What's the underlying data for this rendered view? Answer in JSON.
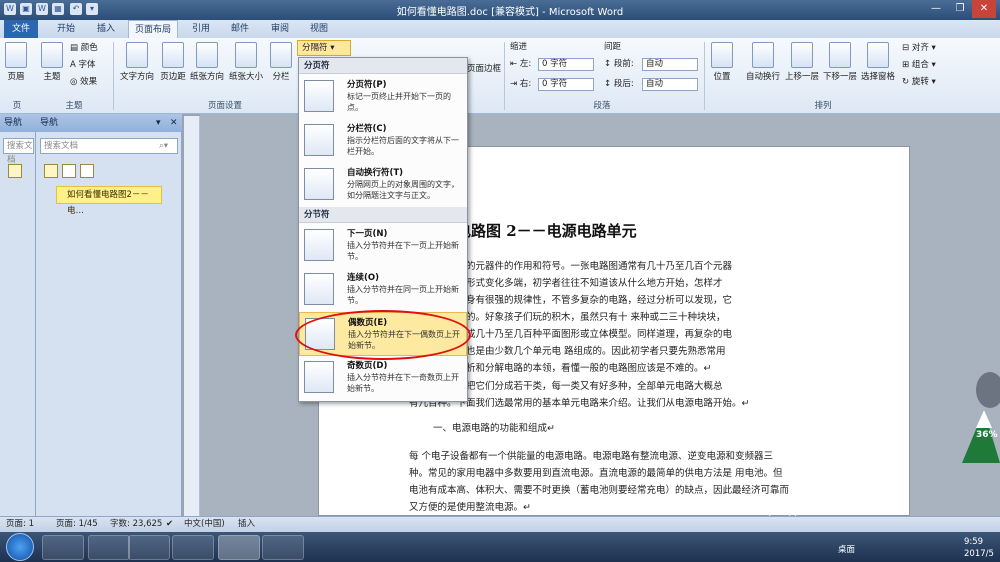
{
  "window": {
    "title": "如何看懂电路图.doc [兼容模式] - Microsoft Word",
    "minimize": "—",
    "maximize": "❐",
    "close": "✕"
  },
  "tabs": [
    "文件",
    "开始",
    "插入",
    "页面布局",
    "引用",
    "邮件",
    "审阅",
    "视图"
  ],
  "ribbon": {
    "theme_buttons": {
      "page": "页眉",
      "theme": "主题",
      "colors": "颜色",
      "fonts": "字体",
      "effects": "效果"
    },
    "page_setup_buttons": [
      "文字方向",
      "页边距",
      "纸张方向",
      "纸张大小",
      "分栏"
    ],
    "breaks_button": "分隔符",
    "page_border": "页面边框",
    "indent": {
      "label": "缩进",
      "left_label": "左",
      "left_value": "0 字符",
      "right_label": "右",
      "right_value": "0 字符"
    },
    "spacing": {
      "label": "间距",
      "before_label": "段前",
      "before_value": "自动",
      "after_label": "段后",
      "after_value": "自动"
    },
    "arrange_buttons": [
      "位置",
      "自动换行",
      "上移一层",
      "下移一层",
      "选择窗格"
    ],
    "arrange_small": [
      "对齐",
      "组合",
      "旋转"
    ],
    "groups": {
      "page_letter": "页",
      "theme": "主题",
      "page_setup": "页面设置",
      "paragraph": "段落",
      "arrange": "排列"
    }
  },
  "breaks_menu": {
    "section_page": "分页符",
    "items_page": [
      {
        "title": "分页符(P)",
        "desc": "标记一页终止并开始下一页的点。"
      },
      {
        "title": "分栏符(C)",
        "desc": "指示分栏符后面的文字将从下一栏开始。"
      },
      {
        "title": "自动换行符(T)",
        "desc": "分隔网页上的对象周围的文字，如分隔题注文字与正文。"
      }
    ],
    "section_section": "分节符",
    "items_section": [
      {
        "title": "下一页(N)",
        "desc": "插入分节符并在下一页上开始新节。"
      },
      {
        "title": "连续(O)",
        "desc": "插入分节符并在同一页上开始新节。"
      },
      {
        "title": "偶数页(E)",
        "desc": "插入分节符并在下一偶数页上开始新节。"
      },
      {
        "title": "奇数页(D)",
        "desc": "插入分节符并在下一奇数页上开始新节。"
      }
    ]
  },
  "nav": {
    "outer_title": "导航",
    "inner_title": "导航",
    "search_placeholder": "搜索文档",
    "inner_search_placeholder": "搜索文档",
    "heading_item": "如何看懂电路图2－－电…"
  },
  "document": {
    "heading": "懂电路图 2－－电源电路单元",
    "paragraphs": [
      "绍了电路图中的元器件的作用和符号。一张电路图通常有几十乃至几百个元器",
      "线纵横交叉，形式变化多端，初学者往往不知道该从什么地方开始，怎样才",
      "实电子电路本身有很强的规律性，不管多复杂的电路，经过分析可以发现，它",
      "单元电路组成的。好象孩子们玩的积木，虽然只有十 来种或二三十种块块，",
      "手中却可以搭成几十乃至几百种平面图形或立体模型。同样道理，再复杂的电",
      "就可发现，它也是由少数几个单元电 路组成的。因此初学者只要先熟悉常用",
      "路，再学会分析和分解电路的本领，看懂一般的电路图应该是不难的。↵",
      "路的功能可以把它们分成若干类，每一类又有好多种，全部单元电路大概总",
      "有几百种。下面我们选最常用的基本单元电路来介绍。让我们从电源电路开始。↵"
    ],
    "section_heading": "一、电源电路的功能和组成↵",
    "body2": [
      "每 个电子设备都有一个供能量的电源电路。电源电路有整流电源、逆变电源和变频器三",
      "种。常见的家用电器中多数要用到直流电源。直流电源的最简单的供电方法是 用电池。但",
      "电池有成本高、体积大、需要不时更换（蓄电池则要经常充电）的缺点，因此最经济可靠而",
      "又方便的是使用整流电源。↵"
    ]
  },
  "status": {
    "page": "页面: 1",
    "pages": "页面: 1/45",
    "words": "字数: 23,625",
    "lang": "中文(中国)",
    "mode": "插入"
  },
  "taskbar": {
    "desktop": "桌面",
    "time": "9:59",
    "date": "2017/5"
  },
  "watermark": {
    "logo": "Baidu经验",
    "url": "jingyan.baidu.com"
  },
  "mascot": {
    "percent": "36%"
  },
  "colors": {
    "accent": "#2b579a",
    "highlight": "#fde9a0",
    "circle": "#e01010"
  }
}
